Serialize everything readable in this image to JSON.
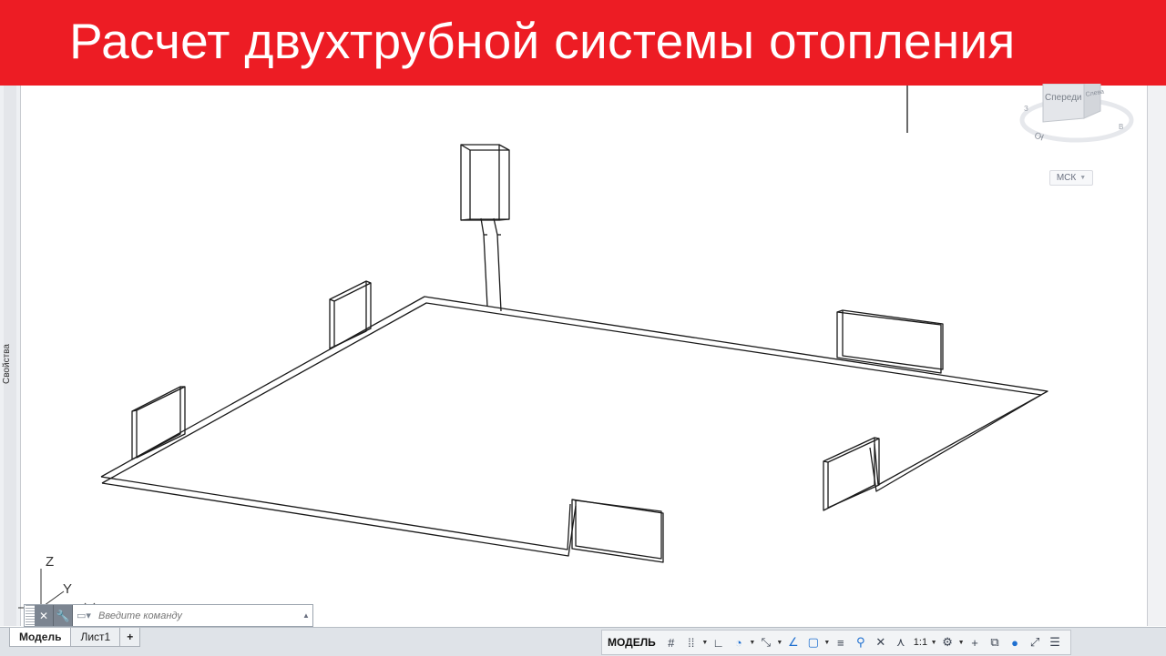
{
  "banner": {
    "title": "Расчет двухтрубной системы отопления",
    "color": "#ed1c24"
  },
  "left_panel": {
    "label": "Свойства"
  },
  "viewcube": {
    "face_label": "Спереди",
    "side_label": "Слева",
    "compass_s": "Ю",
    "compass_w": "З",
    "compass_e": "В"
  },
  "ucs_button": {
    "label": "МСК"
  },
  "ucs_icon": {
    "z_label": "Z",
    "y_label": "Y"
  },
  "command_line": {
    "placeholder": "Введите команду"
  },
  "tabs": [
    {
      "label": "Модель",
      "active": true
    },
    {
      "label": "Лист1",
      "active": false
    },
    {
      "label": "+",
      "active": false
    }
  ],
  "status_bar": {
    "model_label": "МОДЕЛЬ",
    "scale_label": "1:1",
    "icons": [
      "grid-icon",
      "snap-icon",
      "ortho-icon",
      "polar-icon",
      "isodraft-icon",
      "osnap-track-icon",
      "lineweight-icon",
      "transparency-icon",
      "annotation-visibility-icon",
      "autoscale-icon",
      "annotation-scale-icon",
      "workspace-gear-icon",
      "plus-icon",
      "isolate-icon",
      "hardware-accel-icon",
      "fullscreen-icon",
      "customize-menu-icon"
    ]
  }
}
